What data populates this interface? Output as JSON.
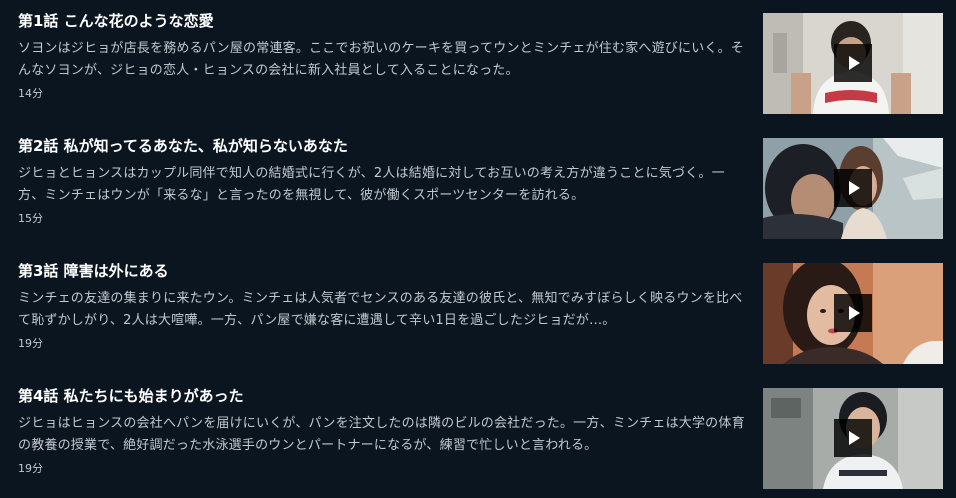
{
  "episodes": [
    {
      "title": "第1話 こんな花のような恋愛",
      "description": "ソヨンはジヒョが店長を務めるパン屋の常連客。ここでお祝いのケーキを買ってウンとミンチェが住む家へ遊びにいく。そんなソヨンが、ジヒョの恋人・ヒョンスの会社に新入社員として入ることになった。",
      "duration": "14分",
      "thumbnail_icon": "play-icon"
    },
    {
      "title": "第2話 私が知ってるあなた、私が知らないあなた",
      "description": "ジヒョとヒョンスはカップル同伴で知人の結婚式に行くが、2人は結婚に対してお互いの考え方が違うことに気づく。一方、ミンチェはウンが「来るな」と言ったのを無視して、彼が働くスポーツセンターを訪れる。",
      "duration": "15分",
      "thumbnail_icon": "play-icon"
    },
    {
      "title": "第3話 障害は外にある",
      "description": "ミンチェの友達の集まりに来たウン。ミンチェは人気者でセンスのある友達の彼氏と、無知でみすぼらしく映るウンを比べて恥ずかしがり、2人は大喧嘩。一方、パン屋で嫌な客に遭遇して辛い1日を過ごしたジヒョだが…。",
      "duration": "19分",
      "thumbnail_icon": "play-icon"
    },
    {
      "title": "第4話 私たちにも始まりがあった",
      "description": "ジヒョはヒョンスの会社へパンを届けにいくが、パンを注文したのは隣のビルの会社だった。一方、ミンチェは大学の体育の教養の授業で、絶好調だった水泳選手のウンとパートナーになるが、練習で忙しいと言われる。",
      "duration": "19分",
      "thumbnail_icon": "play-icon"
    }
  ],
  "colors": {
    "background": "#0b1520",
    "title": "#ffffff",
    "text": "#c2c8cf"
  }
}
